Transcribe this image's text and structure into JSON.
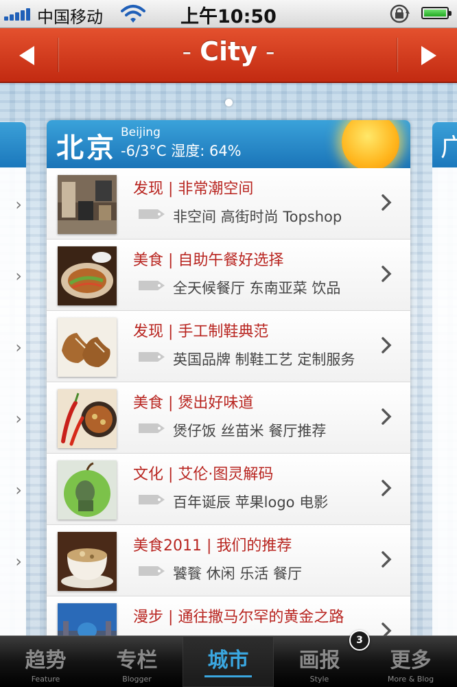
{
  "status_bar": {
    "carrier": "中国移动",
    "time": "上午10:50"
  },
  "nav": {
    "title": "City",
    "title_dash": "-"
  },
  "city_card": {
    "name_cn": "北京",
    "name_en": "Beijing",
    "weather": "-6/3°C 湿度: 64%",
    "icon": "sun-icon",
    "items": [
      {
        "title": "发现 | 非常潮空间",
        "tags": "非空间 高街时尚 Topshop"
      },
      {
        "title": "美食 | 自助午餐好选择",
        "tags": "全天候餐厅 东南亚菜 饮品"
      },
      {
        "title": "发现 | 手工制鞋典范",
        "tags": "英国品牌 制鞋工艺 定制服务"
      },
      {
        "title": "美食 | 煲出好味道",
        "tags": "煲仔饭 丝苗米 餐厅推荐"
      },
      {
        "title": "文化 | 艾伦·图灵解码",
        "tags": "百年诞辰 苹果logo 电影"
      },
      {
        "title": "美食2011 | 我们的推荐",
        "tags": "饕餮 休闲 乐活 餐厅"
      },
      {
        "title": "漫步 | 通往撒马尔罕的黄金之路",
        "tags": ""
      }
    ]
  },
  "right_card_initial": "广",
  "tabbar": {
    "tabs": [
      {
        "cn": "趋势",
        "en": "Feature"
      },
      {
        "cn": "专栏",
        "en": "Blogger"
      },
      {
        "cn": "城市",
        "en": ""
      },
      {
        "cn": "画报",
        "en": "Style"
      },
      {
        "cn": "更多",
        "en": "More & Blog"
      }
    ],
    "active_index": 2,
    "badge": "3"
  },
  "colors": {
    "nav_red": "#d63a1c",
    "city_blue": "#1f82c4",
    "title_red": "#b8241f",
    "active_tab": "#3aa7e0"
  }
}
